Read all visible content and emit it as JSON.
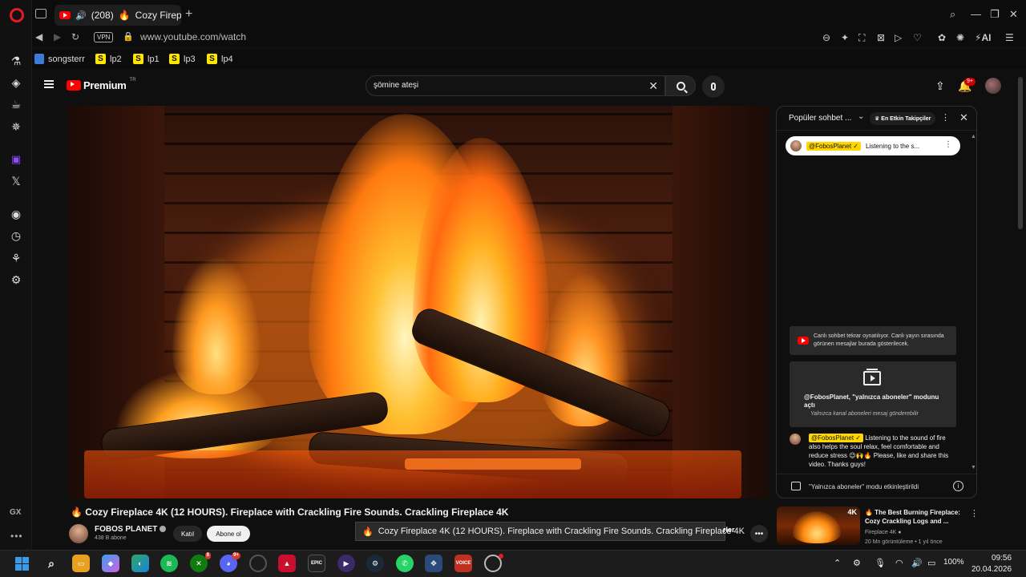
{
  "browser": {
    "tab": {
      "badge": "(208)",
      "title": "Cozy Fireplac"
    },
    "url": "www.youtube.com/watch",
    "vpn_label": "VPN",
    "ai_label": "AI",
    "bookmarks": [
      {
        "label": "songsterr"
      },
      {
        "label": "lp2",
        "icon": "S"
      },
      {
        "label": "lp1",
        "icon": "S"
      },
      {
        "label": "lp3",
        "icon": "S"
      },
      {
        "label": "lp4",
        "icon": "S"
      }
    ],
    "sidebar_gx": "GX"
  },
  "youtube": {
    "logo_text": "Premium",
    "logo_region": "TR",
    "search_value": "şömine ateşi",
    "notification_badge": "9+",
    "video": {
      "title": "Cozy Fireplace 4K (12 HOURS). Fireplace with Crackling Fire Sounds. Crackling Fireplace 4K",
      "channel": "FOBOS PLANET",
      "subscribers": "438 B abone",
      "join_label": "Katıl",
      "subscribe_label": "Abone ol",
      "tooltip": "Cozy Fireplace 4K (12 HOURS). Fireplace with Crackling Fire Sounds. Crackling Fireplace 4K",
      "more_partial": "rler"
    },
    "chat": {
      "title": "Popüler sohbet ...",
      "top_fans_label": "En Etkin Takipçiler",
      "pinned_name": "@FobosPlanet",
      "pinned_text": "Listening to the s...",
      "replay_note": "Canlı sohbet tekrar oynatılıyor. Canlı yayın sırasında görünen mesajlar burada gösterilecek.",
      "members_title": "@FobosPlanet, \"yalnızca aboneler\" modunu açtı",
      "members_sub": "Yalnızca kanal aboneleri mesaj gönderebilir",
      "message_name": "@FobosPlanet",
      "message_text": "Listening to the sound of fire also helps the soul relax, feel comfortable and reduce stress 😉🙌🔥 Please, like and share this video. Thanks guys!",
      "footer_text": "\"Yalnızca aboneler\" modu etkinleştirildi"
    },
    "recommendation": {
      "badge": "4K",
      "title": "🔥 The Best Burning Fireplace: Cozy Crackling Logs and ...",
      "channel": "Fireplace 4K",
      "meta": "20 Mn görüntüleme • 1 yıl önce"
    }
  },
  "taskbar": {
    "discord_badge": "9+",
    "xbox_badge": "8",
    "epic_label": "EPIC",
    "voicemeeter_label": "VOICE",
    "battery": "100%",
    "time": "09:56",
    "date": "20.04.2026"
  },
  "colors": {
    "accent": "#ff0000",
    "chip": "#ffd600",
    "background": "#0f0f0f"
  }
}
